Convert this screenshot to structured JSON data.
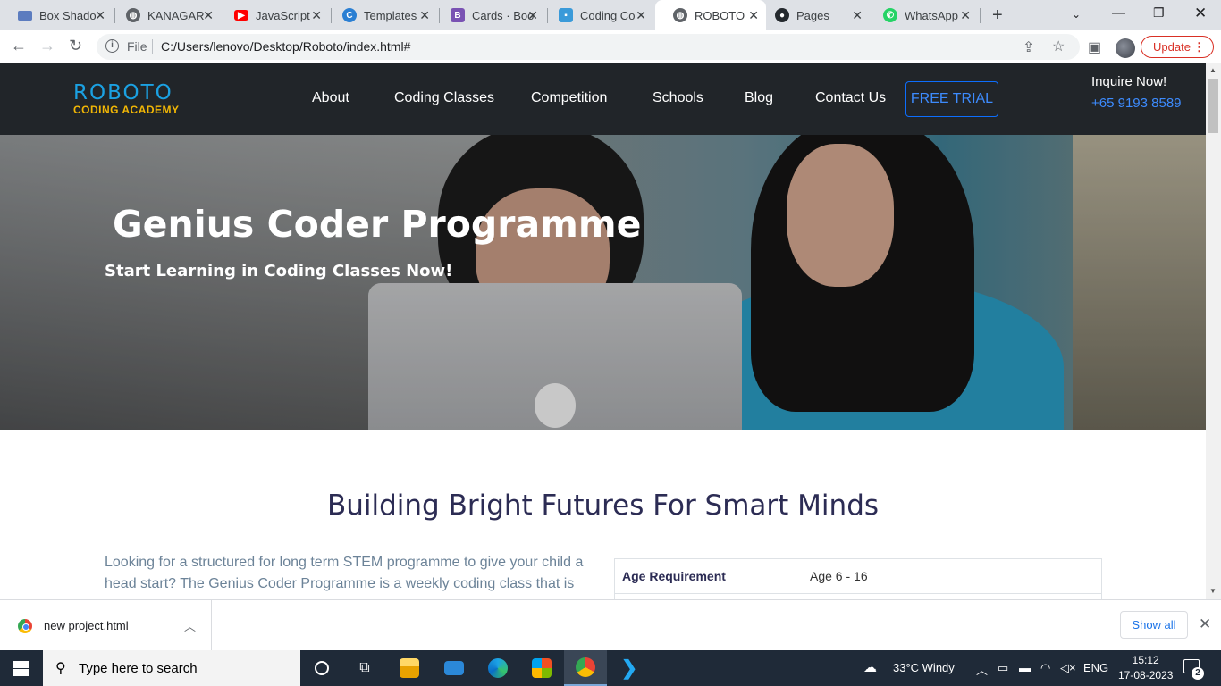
{
  "browser": {
    "tabs": [
      {
        "label": "Box Shado",
        "icon": "slides-icon",
        "color": "#5c7cbf"
      },
      {
        "label": "KANAGAR",
        "icon": "globe-icon",
        "color": "#5f6368"
      },
      {
        "label": "JavaScript",
        "icon": "youtube-icon",
        "color": "#ff0000"
      },
      {
        "label": "Templates",
        "icon": "canva-icon",
        "color": "#2a7fd3"
      },
      {
        "label": "Cards · Boo",
        "icon": "bootstrap-icon",
        "color": "#7952b3"
      },
      {
        "label": "Coding Co",
        "icon": "site-icon",
        "color": "#3a9ad9"
      },
      {
        "label": "ROBOTO",
        "icon": "globe-icon",
        "color": "#5f6368"
      },
      {
        "label": "Pages",
        "icon": "github-icon",
        "color": "#24292e"
      },
      {
        "label": "WhatsApp",
        "icon": "whatsapp-icon",
        "color": "#25d366"
      }
    ],
    "active_tab": 6,
    "omnibox": {
      "scheme_label": "File",
      "url": "C:/Users/lenovo/Desktop/Roboto/index.html#"
    },
    "update_label": "Update"
  },
  "site": {
    "logo": {
      "line1": "ROBOTO",
      "line2": "CODING ACADEMY"
    },
    "menu": [
      "About",
      "Coding Classes",
      "Competition",
      "Schools",
      "Blog",
      "Contact Us"
    ],
    "trial_button": "FREE TRIAL",
    "inquire_label": "Inquire Now!",
    "phone": "+65 9193 8589",
    "hero": {
      "title": "Genius Coder Programme",
      "subtitle": "Start Learning in Coding Classes Now!"
    },
    "section_title": "Building Bright Futures For Smart Minds",
    "body_text": "Looking for a structured for long term STEM programme to give your child a head start? The Genius Coder Programme is a weekly coding class that is",
    "info_table": [
      {
        "key": "Age Requirement",
        "value": "Age 6 - 16"
      },
      {
        "key": "",
        "value": ""
      }
    ]
  },
  "downloads": {
    "file_name": "new project.html",
    "show_all": "Show all"
  },
  "taskbar": {
    "search_placeholder": "Type here to search",
    "weather": "33°C  Windy",
    "language": "ENG",
    "time": "15:12",
    "date": "17-08-2023",
    "notification_count": "2"
  }
}
